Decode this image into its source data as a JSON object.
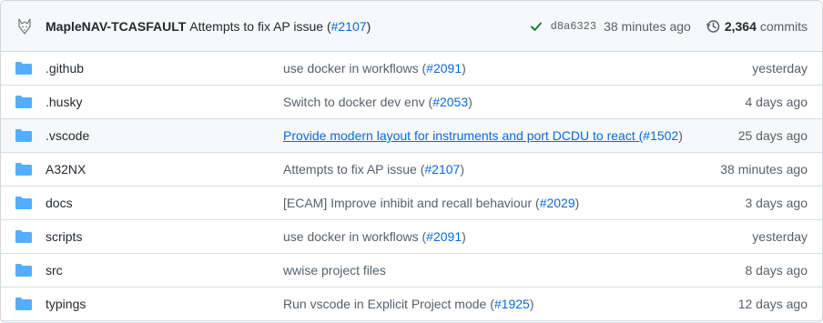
{
  "header": {
    "author": "MapleNAV-TCASFAULT",
    "message": "Attempts to fix AP issue (",
    "pr_link": "#2107",
    "message_end": ")",
    "sha": "d8a6323",
    "time_ago": "38 minutes ago",
    "commit_count": "2,364",
    "commits_label": "commits",
    "check_color": "#1a7f37",
    "icons": [
      "wolf-avatar",
      "check-icon",
      "history-icon"
    ]
  },
  "rows": [
    {
      "name": ".github",
      "message": "use docker in workflows (",
      "pr": "#2091",
      "end": ")",
      "age": "yesterday"
    },
    {
      "name": ".husky",
      "message": "Switch to docker dev env (",
      "pr": "#2053",
      "end": ")",
      "age": "4 days ago"
    },
    {
      "name": ".vscode",
      "message": "Provide modern layout for instruments and port DCDU to react (",
      "pr": "#1502",
      "end": ")",
      "age": "25 days ago"
    },
    {
      "name": "A32NX",
      "message": "Attempts to fix AP issue (",
      "pr": "#2107",
      "end": ")",
      "age": "38 minutes ago"
    },
    {
      "name": "docs",
      "message": "[ECAM] Improve inhibit and recall behaviour (",
      "pr": "#2029",
      "end": ")",
      "age": "3 days ago"
    },
    {
      "name": "scripts",
      "message": "use docker in workflows (",
      "pr": "#2091",
      "end": ")",
      "age": "yesterday"
    },
    {
      "name": "src",
      "message": "wwise project files",
      "pr": "",
      "end": "",
      "age": "8 days ago"
    },
    {
      "name": "typings",
      "message": "Run vscode in Explicit Project mode (",
      "pr": "#1925",
      "end": ")",
      "age": "12 days ago"
    }
  ],
  "folder_color": "#54aeff"
}
